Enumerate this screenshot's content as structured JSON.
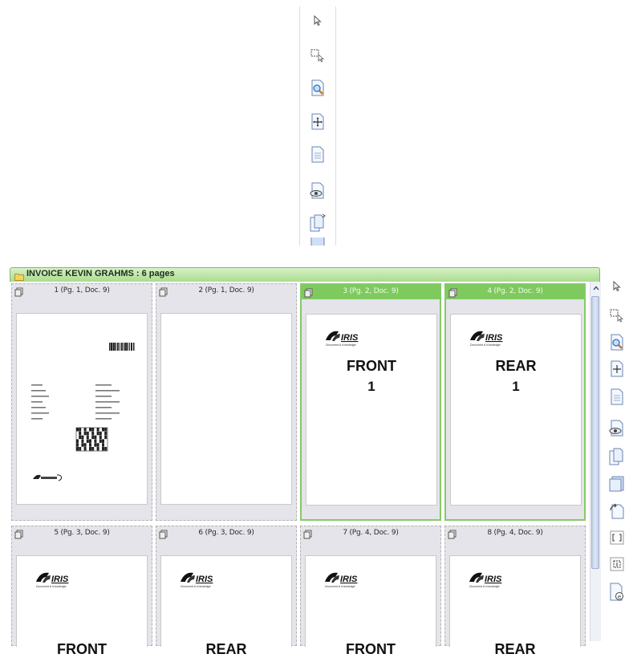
{
  "top_toolbar": {
    "tools": [
      "select-pointer-icon",
      "region-select-icon",
      "zoom-icon",
      "pan-icon",
      "page-view-icon",
      "preview-icon",
      "copy-pages-icon",
      "document-icon"
    ]
  },
  "group": {
    "title": "INVOICE KEVIN GRAHMS : 6 pages"
  },
  "tiles": [
    {
      "label": "1 (Pg. 1, Doc. 9)",
      "selected": false,
      "content": "invoice"
    },
    {
      "label": "2 (Pg. 1, Doc. 9)",
      "selected": false,
      "content": "blank"
    },
    {
      "label": "3 (Pg. 2, Doc. 9)",
      "selected": true,
      "content": "card",
      "text1": "FRONT",
      "text2": "1"
    },
    {
      "label": "4 (Pg. 2, Doc. 9)",
      "selected": true,
      "content": "card",
      "text1": "REAR",
      "text2": "1"
    },
    {
      "label": "5 (Pg. 3, Doc. 9)",
      "selected": false,
      "content": "card",
      "text1": "FRONT"
    },
    {
      "label": "6 (Pg. 3, Doc. 9)",
      "selected": false,
      "content": "card",
      "text1": "REAR"
    },
    {
      "label": "7 (Pg. 4, Doc. 9)",
      "selected": false,
      "content": "card",
      "text1": "FRONT"
    },
    {
      "label": "8 (Pg. 4, Doc. 9)",
      "selected": false,
      "content": "card",
      "text1": "REAR"
    }
  ],
  "logo_text": "IRIS",
  "logo_tagline": "Document & Knowledge",
  "side_toolbar": {
    "tools": [
      "select-pointer-icon",
      "region-select-icon",
      "zoom-icon",
      "pan-icon",
      "page-view-icon",
      "preview-icon",
      "copy-pages-icon",
      "document-icon",
      "rotate-icon",
      "crop-icon",
      "split-icon",
      "export-icon"
    ]
  },
  "colors": {
    "accent": "#7fca5f",
    "header": "#a9dc8d",
    "tile_bg": "#e4e4ea"
  }
}
